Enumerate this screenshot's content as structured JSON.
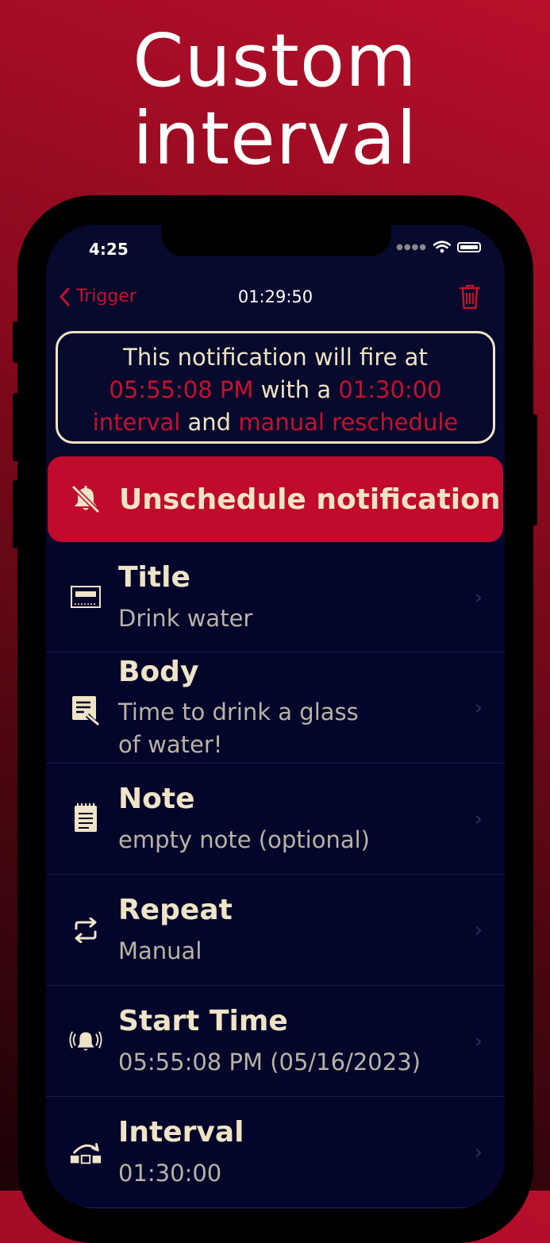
{
  "headline": {
    "line1": "Custom",
    "line2": "interval"
  },
  "status_bar": {
    "time": "4:25",
    "icons": [
      "signal-dots-icon",
      "wifi-icon",
      "battery-icon"
    ]
  },
  "navbar": {
    "back_label": "Trigger",
    "title": "01:29:50",
    "trash_icon": "trash-icon"
  },
  "info": {
    "prefix": "This notification will fire at",
    "fire_time": "05:55:08 PM",
    "with_a": "with a",
    "interval": "01:30:00",
    "interval_word": "interval",
    "and": "and",
    "reschedule": "manual reschedule"
  },
  "unschedule": {
    "label": "Unschedule notification",
    "icon": "bell-slash-icon"
  },
  "rows": [
    {
      "title": "Title",
      "value": "Drink water",
      "icon": "title-field-icon"
    },
    {
      "title": "Body",
      "value": "Time to drink a glass of water!",
      "value_line1": "Time to drink a glass",
      "value_line2": "of water!",
      "icon": "text-edit-icon"
    },
    {
      "title": "Note",
      "value": "empty note (optional)",
      "icon": "notepad-icon"
    },
    {
      "title": "Repeat",
      "value": "Manual",
      "icon": "repeat-icon"
    },
    {
      "title": "Start Time",
      "value": "05:55:08 PM (05/16/2023)",
      "icon": "ringing-bell-icon"
    },
    {
      "title": "Interval",
      "value": "01:30:00",
      "icon": "interval-icon"
    }
  ],
  "colors": {
    "accent": "#c8102e",
    "text": "#efe4c6",
    "background": "#070a2c",
    "button": "#c00b2c"
  }
}
